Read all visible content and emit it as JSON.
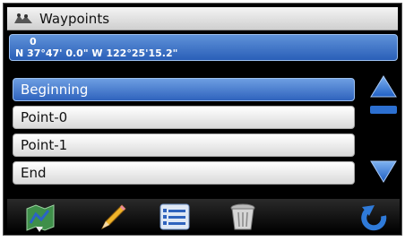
{
  "title": {
    "text": "Waypoints",
    "icon": "waypoints-icon"
  },
  "location": {
    "index": "0",
    "coordinates": "N 37°47' 0.0\"  W 122°25'15.2\""
  },
  "list": {
    "items": [
      {
        "label": "Beginning",
        "selected": true
      },
      {
        "label": "Point-0",
        "selected": false
      },
      {
        "label": "Point-1",
        "selected": false
      },
      {
        "label": "End",
        "selected": false
      }
    ]
  },
  "scroll": {
    "up_icon": "arrow-up-icon",
    "down_icon": "arrow-down-icon"
  },
  "toolbar": {
    "tools": [
      "map-icon",
      "pencil-icon",
      "list-icon",
      "trash-icon",
      "back-icon"
    ]
  },
  "colors": {
    "accent": "#2f63bd",
    "background": "#000000"
  }
}
